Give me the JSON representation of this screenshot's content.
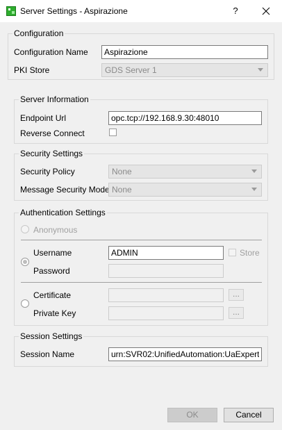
{
  "window": {
    "title": "Server Settings - Aspirazione",
    "help_label": "?"
  },
  "configuration": {
    "legend": "Configuration",
    "name_label": "Configuration Name",
    "name_value": "Aspirazione",
    "pki_label": "PKI Store",
    "pki_value": "GDS Server 1"
  },
  "server_info": {
    "legend": "Server Information",
    "endpoint_label": "Endpoint Url",
    "endpoint_value": "opc.tcp://192.168.9.30:48010",
    "reverse_label": "Reverse Connect"
  },
  "security": {
    "legend": "Security Settings",
    "policy_label": "Security Policy",
    "policy_value": "None",
    "mode_label": "Message Security Mode",
    "mode_value": "None"
  },
  "auth": {
    "legend": "Authentication Settings",
    "anonymous_label": "Anonymous",
    "username_label": "Username",
    "username_value": "ADMIN",
    "store_label": "Store",
    "password_label": "Password",
    "certificate_label": "Certificate",
    "private_key_label": "Private Key",
    "browse_label": "..."
  },
  "session": {
    "legend": "Session Settings",
    "name_label": "Session Name",
    "name_value": "urn:SVR02:UnifiedAutomation:UaExpert"
  },
  "buttons": {
    "ok_label": "OK",
    "cancel_label": "Cancel"
  }
}
